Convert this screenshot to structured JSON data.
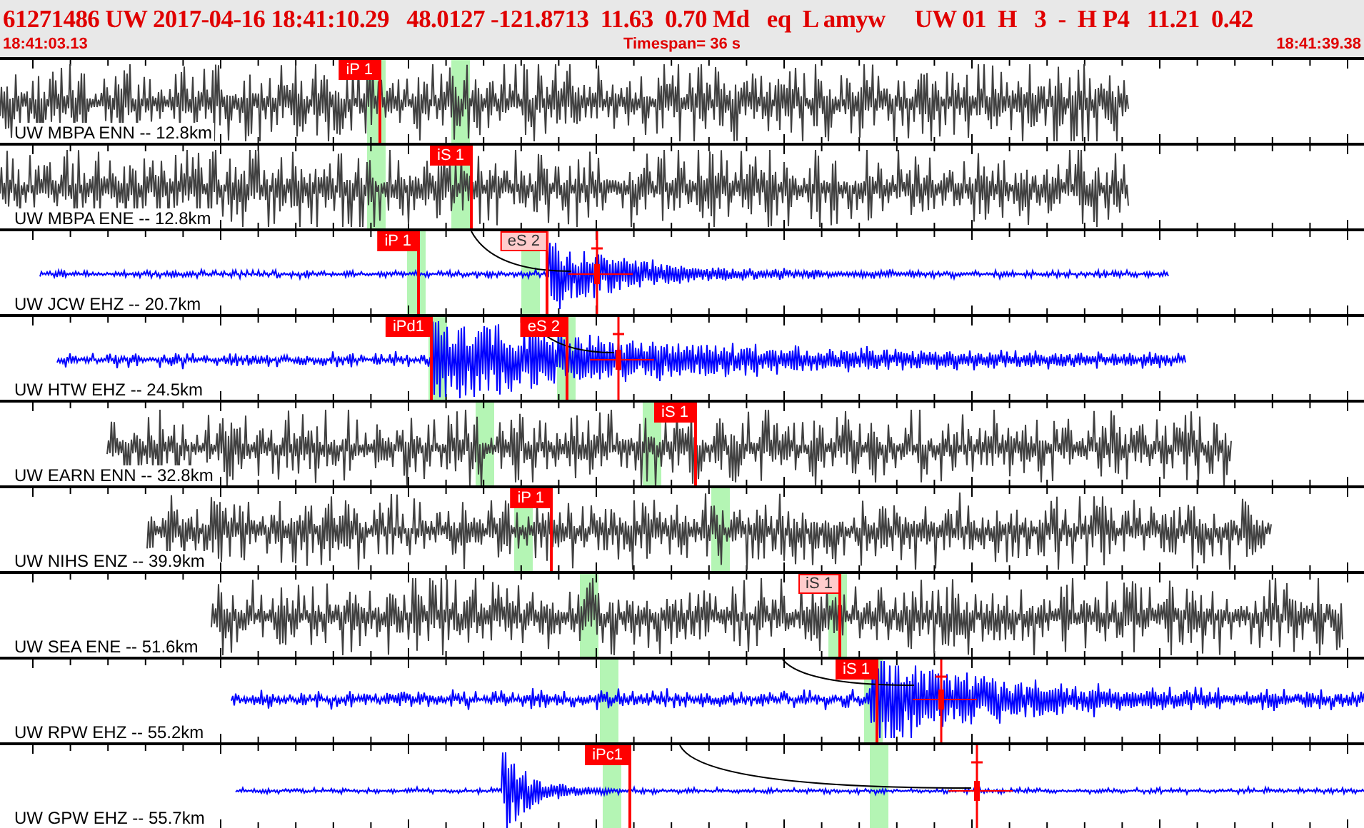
{
  "header": {
    "event_line": "61271486 UW 2017-04-16 18:41:10.29   48.0127 -121.8713  11.63  0.70 Md   eq  L amyw     UW 01  H   3  -  H P4   11.21  0.42",
    "start_time": "18:41:03.13",
    "timespan": "Timespan=  36 s",
    "end_time": "18:41:39.38"
  },
  "traces": [
    {
      "label": "UW MBPA ENN -- 12.8km",
      "color": "#404040",
      "picks": [
        {
          "label": "iP 1",
          "muted": false
        }
      ]
    },
    {
      "label": "UW MBPA ENE -- 12.8km",
      "color": "#404040",
      "picks": [
        {
          "label": "iS 1",
          "muted": false
        }
      ]
    },
    {
      "label": "UW JCW EHZ -- 20.7km",
      "color": "#0000ff",
      "picks": [
        {
          "label": "iP 1",
          "muted": false
        },
        {
          "label": "eS 2",
          "muted": true
        }
      ]
    },
    {
      "label": "UW HTW EHZ -- 24.5km",
      "color": "#0000ff",
      "picks": [
        {
          "label": "iPd1",
          "muted": false
        },
        {
          "label": "eS 2",
          "muted": false
        }
      ]
    },
    {
      "label": "UW EARN ENN -- 32.8km",
      "color": "#404040",
      "picks": [
        {
          "label": "iS 1",
          "muted": false
        }
      ]
    },
    {
      "label": "UW NIHS ENZ -- 39.9km",
      "color": "#404040",
      "picks": [
        {
          "label": "iP 1",
          "muted": false
        }
      ]
    },
    {
      "label": "UW SEA ENE -- 51.6km",
      "color": "#404040",
      "picks": [
        {
          "label": "iS 1",
          "muted": true
        }
      ]
    },
    {
      "label": "UW RPW EHZ -- 55.2km",
      "color": "#0000ff",
      "picks": [
        {
          "label": "iS 1",
          "muted": false
        }
      ]
    },
    {
      "label": "UW GPW EHZ -- 55.7km",
      "color": "#0000ff",
      "picks": [
        {
          "label": "iPc1",
          "muted": false
        }
      ]
    }
  ]
}
